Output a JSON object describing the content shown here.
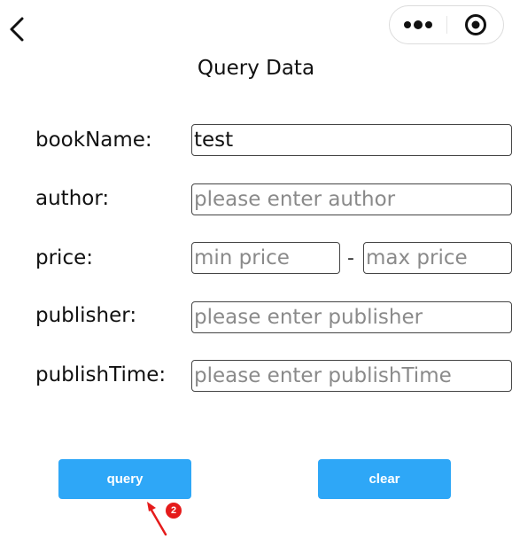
{
  "nav": {
    "back_icon": "chevron-left-icon",
    "capsule": {
      "more_icon": "more-dots-icon",
      "close_icon": "target-close-icon"
    }
  },
  "page": {
    "title": "Query Data"
  },
  "form": {
    "book_name": {
      "label": "bookName:",
      "value": "test",
      "placeholder": ""
    },
    "author": {
      "label": "author:",
      "value": "",
      "placeholder": "please enter author"
    },
    "price": {
      "label": "price:",
      "min_placeholder": "min price",
      "max_placeholder": "max price",
      "separator": "-"
    },
    "publisher": {
      "label": "publisher:",
      "value": "",
      "placeholder": "please enter publisher"
    },
    "publish_time": {
      "label": "publishTime:",
      "value": "",
      "placeholder": "please enter publishTime"
    }
  },
  "actions": {
    "query_label": "query",
    "clear_label": "clear"
  },
  "annotation": {
    "badge": "2",
    "color": "#e51b1b"
  },
  "colors": {
    "button": "#2ea7f7"
  }
}
